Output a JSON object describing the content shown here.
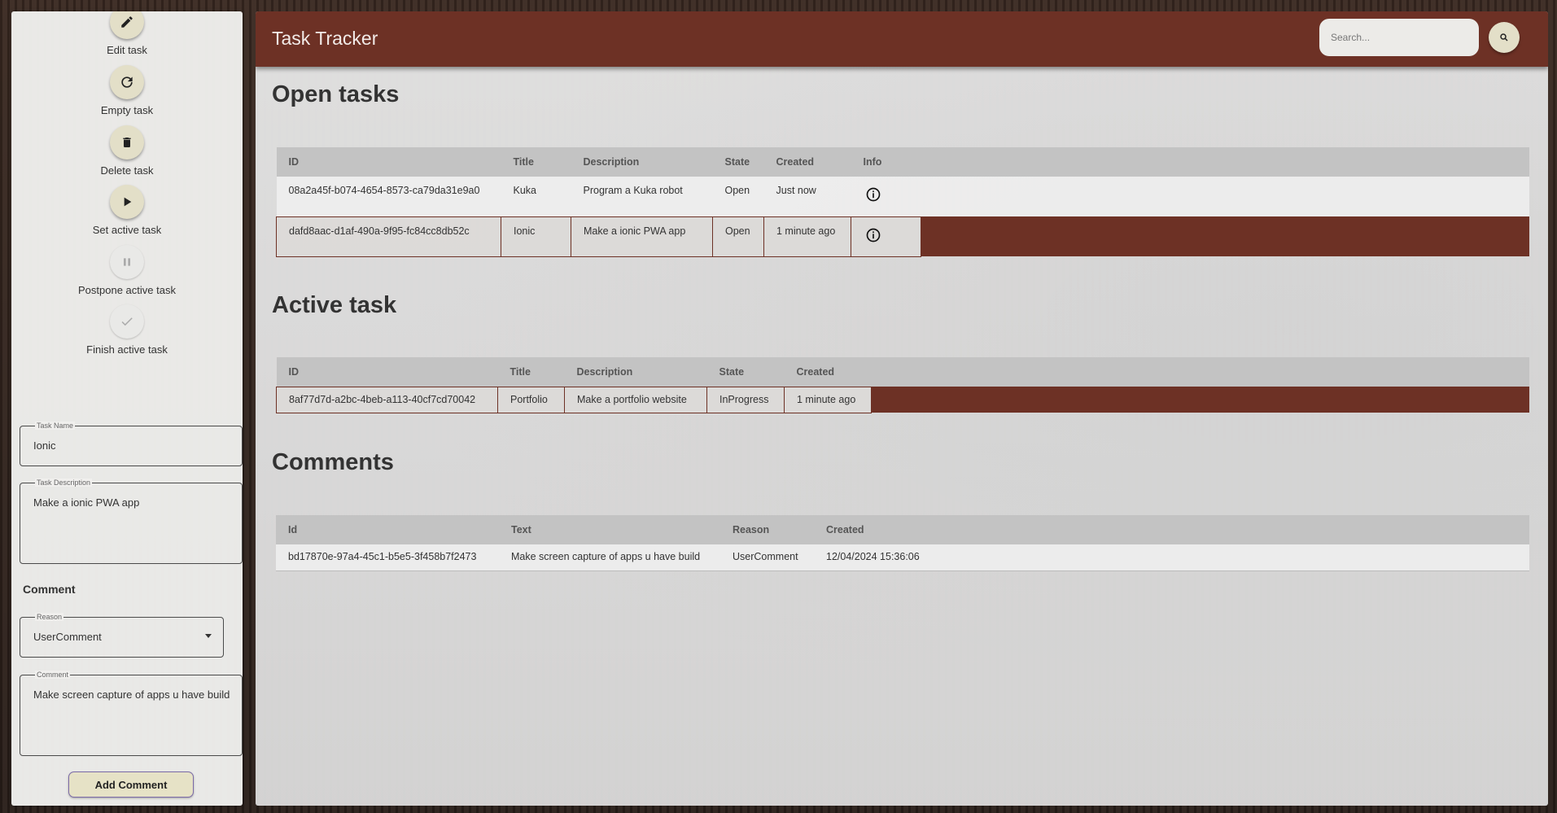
{
  "sidebar": {
    "actions": [
      {
        "label": "Edit task",
        "icon": "pencil-icon"
      },
      {
        "label": "Empty task",
        "icon": "refresh-icon"
      },
      {
        "label": "Delete task",
        "icon": "trash-icon"
      },
      {
        "label": "Set active task",
        "icon": "play-icon"
      },
      {
        "label": "Postpone active task",
        "icon": "pause-icon"
      },
      {
        "label": "Finish active task",
        "icon": "check-icon"
      }
    ],
    "task_name": {
      "legend": "Task Name",
      "value": "Ionic"
    },
    "task_description": {
      "legend": "Task Description",
      "value": "Make a ionic PWA app"
    },
    "comment_heading": "Comment",
    "reason": {
      "legend": "Reason",
      "value": "UserComment"
    },
    "comment": {
      "legend": "Comment",
      "value": "Make screen capture of apps u have build"
    },
    "add_comment_label": "Add Comment"
  },
  "header": {
    "title": "Task Tracker",
    "search_placeholder": "Search..."
  },
  "open_tasks": {
    "title": "Open tasks",
    "columns": [
      "ID",
      "Title",
      "Description",
      "State",
      "Created",
      "Info"
    ],
    "rows": [
      {
        "id": "08a2a45f-b074-4654-8573-ca79da31e9a0",
        "title": "Kuka",
        "description": "Program a Kuka robot",
        "state": "Open",
        "created": "Just now"
      },
      {
        "id": "dafd8aac-d1af-490a-9f95-fc84cc8db52c",
        "title": "Ionic",
        "description": "Make a ionic PWA app",
        "state": "Open",
        "created": "1 minute ago"
      }
    ]
  },
  "active_task": {
    "title": "Active task",
    "columns": [
      "ID",
      "Title",
      "Description",
      "State",
      "Created"
    ],
    "row": {
      "id": "8af77d7d-a2bc-4beb-a113-40cf7cd70042",
      "title": "Portfolio",
      "description": "Make a portfolio website",
      "state": "InProgress",
      "created": "1 minute ago"
    }
  },
  "comments": {
    "title": "Comments",
    "columns": [
      "Id",
      "Text",
      "Reason",
      "Created"
    ],
    "row": {
      "id": "bd17870e-97a4-45c1-b5e5-3f458b7f2473",
      "text": "Make screen capture of apps u have build",
      "reason": "UserComment",
      "created": "12/04/2024 15:36:06"
    }
  },
  "colors": {
    "accent": "#6d3125",
    "button": "#e3dfc8"
  }
}
